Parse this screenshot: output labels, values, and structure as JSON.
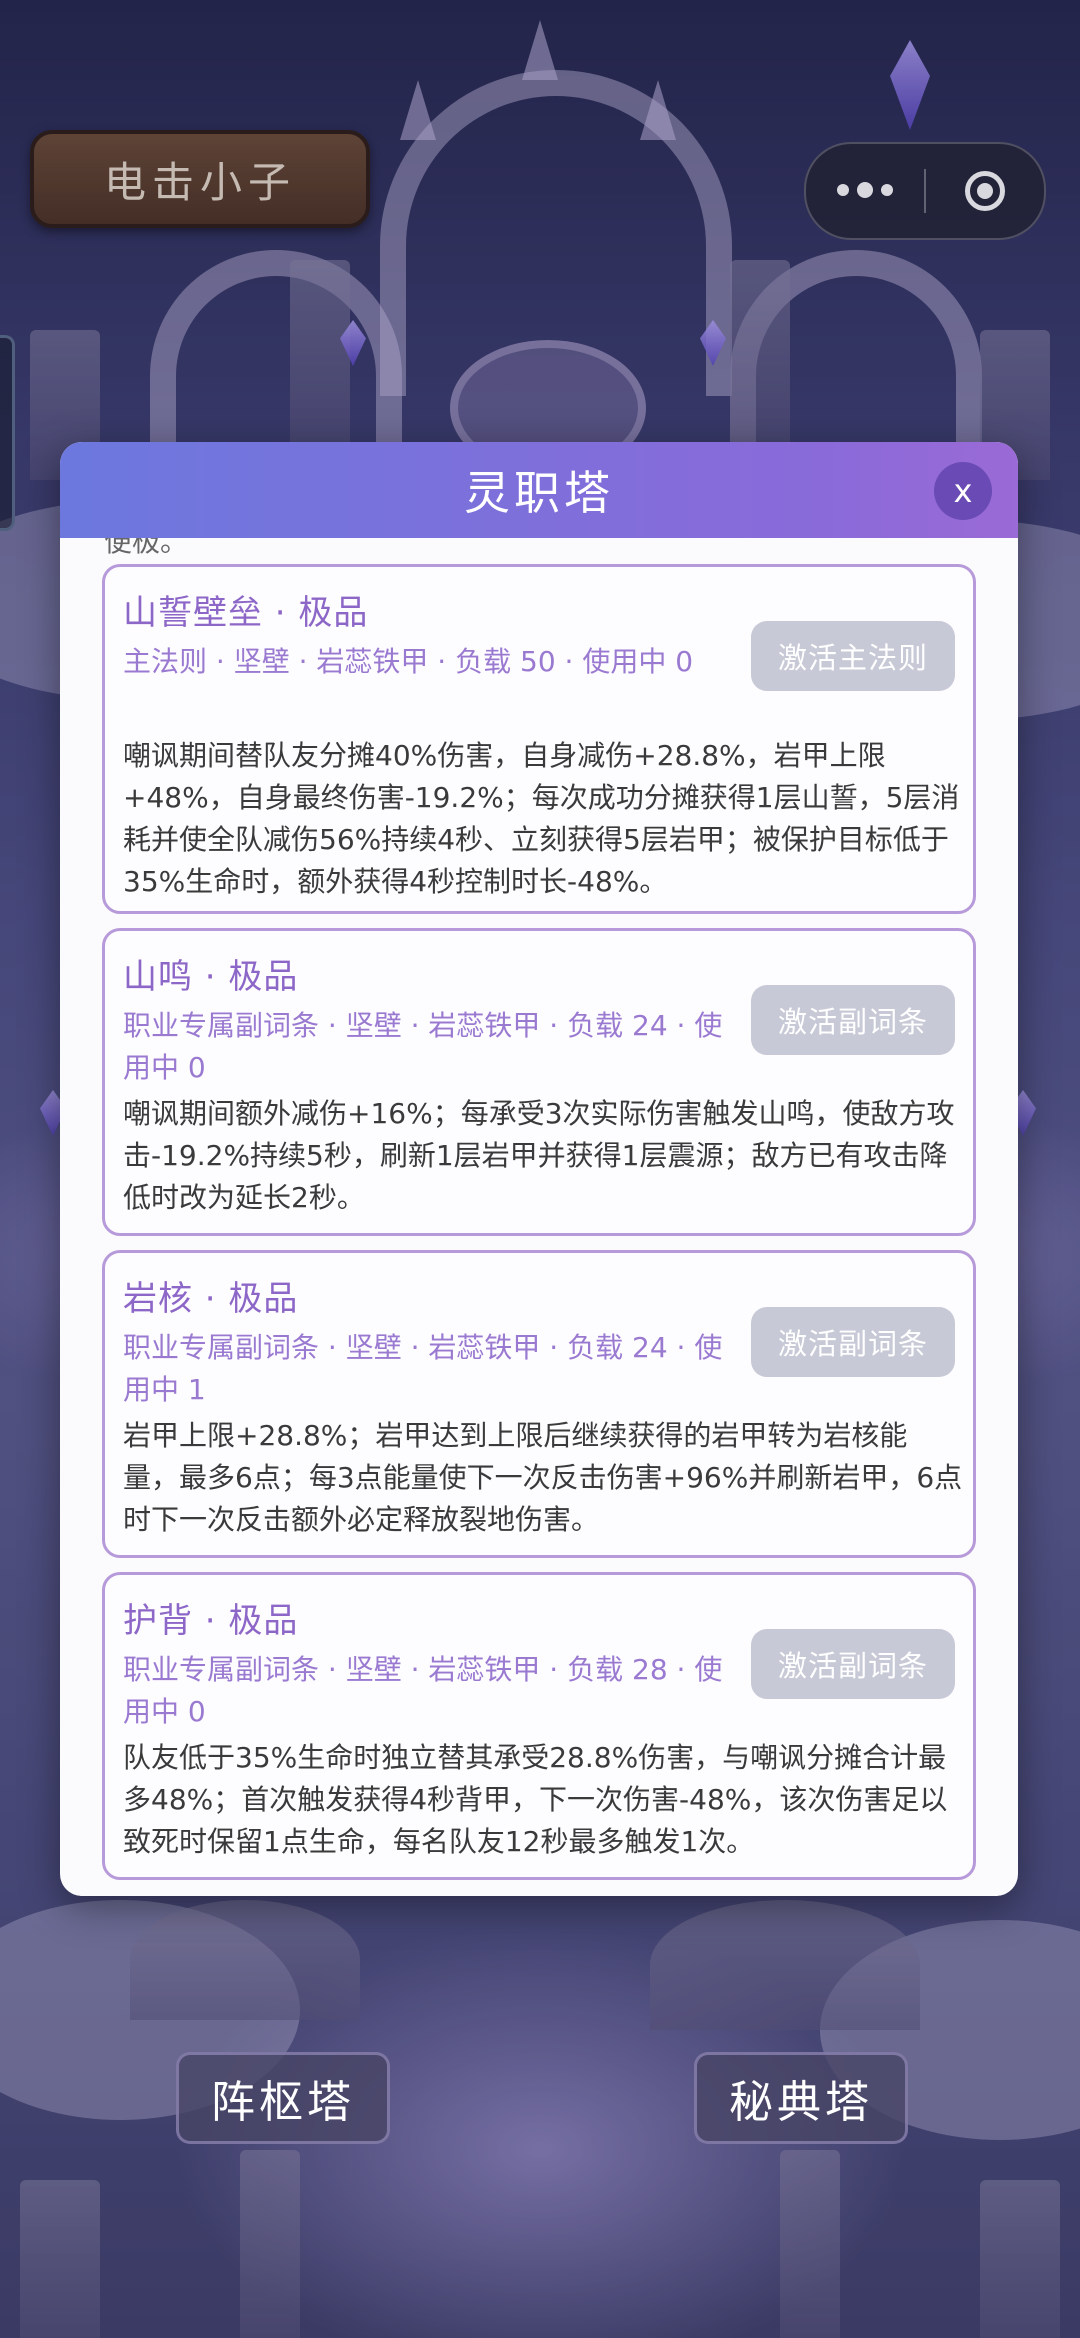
{
  "header": {
    "sign_text": "电击小子"
  },
  "capsule": {
    "more_icon": "more-dots-icon",
    "close_icon": "target-circle-icon"
  },
  "modal": {
    "title": "灵职塔",
    "close_label": "x",
    "cut_text": "便极。",
    "cards": [
      {
        "title": "山誓壁垒 · 极品",
        "meta": "主法则 · 坚壁 · 岩蕊铁甲 · 负载 50 · 使用中 0",
        "button": "激活主法则",
        "desc": "嘲讽期间替队友分摊40%伤害，自身减伤+28.8%，岩甲上限+48%，自身最终伤害-19.2%；每次成功分摊获得1层山誓，5层消耗并使全队减伤56%持续4秒、立刻获得5层岩甲；被保护目标低于35%生命时，额外获得4秒控制时长-48%。"
      },
      {
        "title": "山鸣 · 极品",
        "meta": "职业专属副词条 · 坚壁 · 岩蕊铁甲 · 负载 24 · 使用中 0",
        "button": "激活副词条",
        "desc": "嘲讽期间额外减伤+16%；每承受3次实际伤害触发山鸣，使敌方攻击-19.2%持续5秒，刷新1层岩甲并获得1层震源；敌方已有攻击降低时改为延长2秒。"
      },
      {
        "title": "岩核 · 极品",
        "meta": "职业专属副词条 · 坚壁 · 岩蕊铁甲 · 负载 24 · 使用中 1",
        "button": "激活副词条",
        "desc": "岩甲上限+28.8%；岩甲达到上限后继续获得的岩甲转为岩核能量，最多6点；每3点能量使下一次反击伤害+96%并刷新岩甲，6点时下一次反击额外必定释放裂地伤害。"
      },
      {
        "title": "护背 · 极品",
        "meta": "职业专属副词条 · 坚壁 · 岩蕊铁甲 · 负载 28 · 使用中 0",
        "button": "激活副词条",
        "desc": "队友低于35%生命时独立替其承受28.8%伤害，与嘲讽分摊合计最多48%；首次触发获得4秒背甲，下一次伤害-48%，该次伤害足以致死时保留1点生命，每名队友12秒最多触发1次。"
      }
    ]
  },
  "bottom": {
    "left_tower": "阵枢塔",
    "right_tower": "秘典塔"
  }
}
